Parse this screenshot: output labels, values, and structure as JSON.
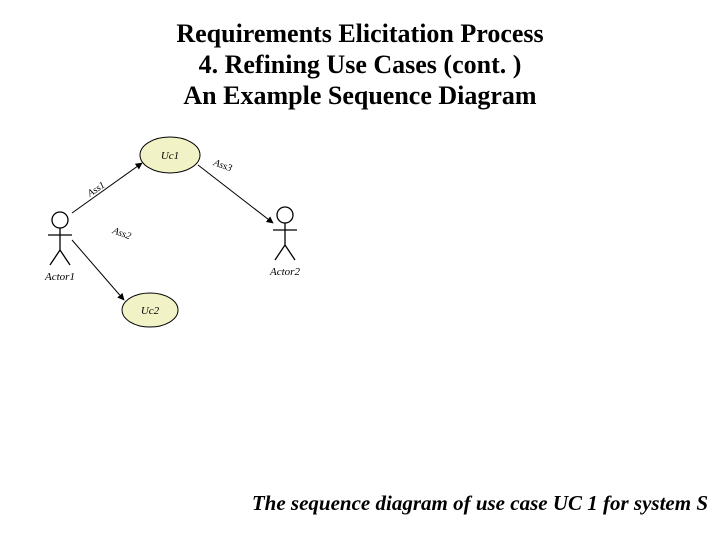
{
  "title": {
    "line1": "Requirements Elicitation Process",
    "line2": "4. Refining Use Cases (cont. )",
    "line3": "An Example Sequence Diagram"
  },
  "diagram": {
    "usecases": {
      "uc1": "Uc1",
      "uc2": "Uc2"
    },
    "actors": {
      "actor1": "Actor1",
      "actor2": "Actor2"
    },
    "associations": {
      "ass1": "Ass1",
      "ass2": "Ass2",
      "ass3": "Ass3"
    },
    "colors": {
      "usecase_fill": "#f2f2c7",
      "stroke": "#000000"
    }
  },
  "caption": "The sequence diagram of use case UC 1 for system S"
}
